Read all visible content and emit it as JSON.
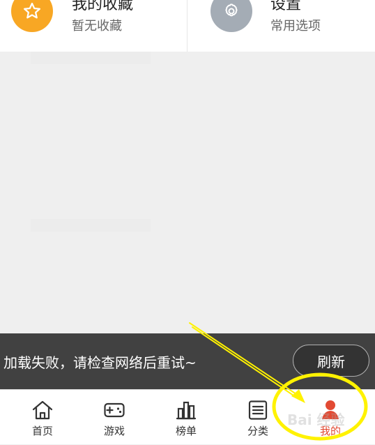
{
  "cards": {
    "favorites": {
      "title": "我的收藏",
      "subtitle": "暂无收藏",
      "icon": "star-icon",
      "icon_color": "#f8a724"
    },
    "settings": {
      "title": "设置",
      "subtitle": "常用选项",
      "icon": "gear-icon",
      "icon_color": "#a4acb5"
    }
  },
  "error_bar": {
    "message": "加载失败，请检查网络后重试~",
    "refresh_label": "刷新"
  },
  "tabs": [
    {
      "label": "首页",
      "icon": "home-icon"
    },
    {
      "label": "游戏",
      "icon": "gamepad-icon"
    },
    {
      "label": "榜单",
      "icon": "chart-icon"
    },
    {
      "label": "分类",
      "icon": "list-icon"
    },
    {
      "label": "我的",
      "icon": "user-icon",
      "active": true
    }
  ],
  "watermark": "Bai 经验",
  "colors": {
    "accent_active": "#e24a33",
    "annotation_yellow": "#fff200",
    "error_bar_bg": "#414141"
  }
}
